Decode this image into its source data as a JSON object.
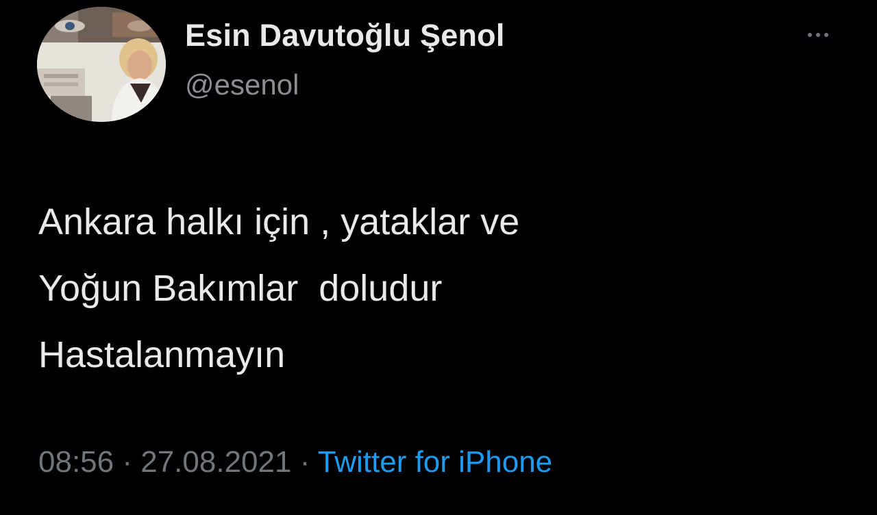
{
  "author": {
    "display_name": "Esin Davutoğlu Şenol",
    "handle": "@esenol"
  },
  "tweet": {
    "lines": [
      "Ankara halkı için , yataklar ve",
      "Yoğun Bakımlar  doludur",
      "Hastalanmayın"
    ]
  },
  "meta": {
    "time": "08:56",
    "separator": "·",
    "date": "27.08.2021",
    "source": "Twitter for iPhone"
  },
  "icons": {
    "more": "more-horizontal-icon"
  },
  "colors": {
    "background": "#000000",
    "text_primary": "#e7e9ea",
    "text_secondary": "#71767b",
    "link": "#1d9bf0"
  }
}
